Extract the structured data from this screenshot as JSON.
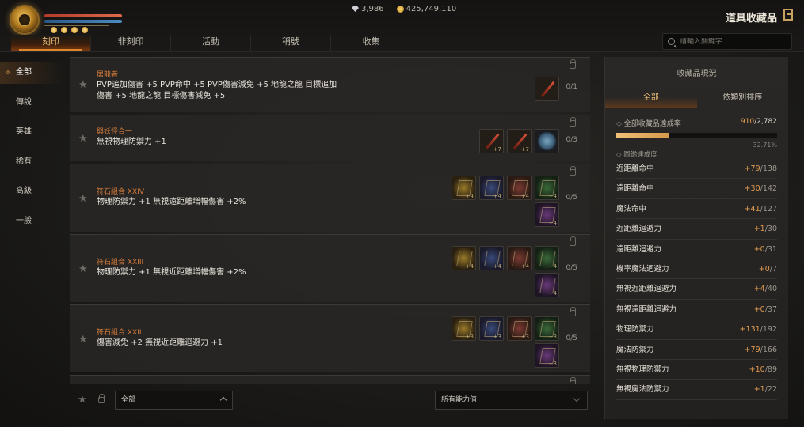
{
  "currency": {
    "gems": "3,986",
    "gold": "425,749,110"
  },
  "header": {
    "title": "道具收藏品"
  },
  "tabs": [
    {
      "label": "刻印",
      "active": true
    },
    {
      "label": "非刻印",
      "active": false
    },
    {
      "label": "活動",
      "active": false
    },
    {
      "label": "稱號",
      "active": false
    },
    {
      "label": "收集",
      "active": false
    }
  ],
  "search": {
    "placeholder": "請輸入關鍵字."
  },
  "sidebar": {
    "items": [
      {
        "label": "全部",
        "active": true
      },
      {
        "label": "傳說",
        "active": false
      },
      {
        "label": "英雄",
        "active": false
      },
      {
        "label": "稀有",
        "active": false
      },
      {
        "label": "高級",
        "active": false
      },
      {
        "label": "一般",
        "active": false
      }
    ]
  },
  "collections": [
    {
      "category": "屠龍者",
      "desc_line1": "PVP追加傷害 +5 PVP命中 +5 PVP傷害減免 +5 地龍之龍 目標追加",
      "desc_line2": "傷害 +5 地龍之龍 目標傷害減免 +5",
      "count": "0/1",
      "slots": [
        {
          "icon": "sword-icon",
          "plus": ""
        }
      ]
    },
    {
      "category": "與妖怪合一",
      "desc_line1": "無視物理防禦力 +1",
      "count": "0/3",
      "slots": [
        {
          "icon": "sword-icon",
          "plus": "+7"
        },
        {
          "icon": "sword-icon",
          "plus": "+7"
        },
        {
          "icon": "orb-icon",
          "plus": ""
        }
      ]
    },
    {
      "category": "符石組合 XXIV",
      "desc_line1": "物理防禦力 +1 無視遠距離增幅傷害 +2%",
      "count": "0/5",
      "slots": [
        {
          "icon": "rune-gold-icon",
          "plus": "+4"
        },
        {
          "icon": "rune-blue-icon",
          "plus": "+4"
        },
        {
          "icon": "rune-red-icon",
          "plus": "+4"
        },
        {
          "icon": "rune-green-icon",
          "plus": "+4"
        },
        {
          "icon": "rune-purple-icon",
          "plus": "+4"
        }
      ]
    },
    {
      "category": "符石組合 XXIII",
      "desc_line1": "物理防禦力 +1 無視近距離增幅傷害 +2%",
      "count": "0/5",
      "slots": [
        {
          "icon": "rune-gold-icon",
          "plus": "+4"
        },
        {
          "icon": "rune-blue-icon",
          "plus": "+4"
        },
        {
          "icon": "rune-red-icon",
          "plus": "+4"
        },
        {
          "icon": "rune-green-icon",
          "plus": "+4"
        },
        {
          "icon": "rune-purple-icon",
          "plus": "+4"
        }
      ]
    },
    {
      "category": "符石組合 XXII",
      "desc_line1": "傷害減免 +2 無視近距離迴避力 +1",
      "count": "0/5",
      "slots": [
        {
          "icon": "rune-gold-icon",
          "plus": "+3"
        },
        {
          "icon": "rune-blue-icon",
          "plus": "+3"
        },
        {
          "icon": "rune-red-icon",
          "plus": "+3"
        },
        {
          "icon": "rune-green-icon",
          "plus": "+3"
        },
        {
          "icon": "rune-purple-icon",
          "plus": "+3"
        }
      ]
    }
  ],
  "filters": {
    "grade": "全部",
    "stat": "所有能力值"
  },
  "panel": {
    "title": "收藏品現況",
    "tabs": [
      {
        "label": "全部",
        "active": true
      },
      {
        "label": "依類別排序",
        "active": false
      }
    ],
    "summary_label": "全部收藏品達成率",
    "summary_current": "910",
    "summary_total": "/2,782",
    "summary_fraction": 0.3271,
    "summary_percent": "32.71%",
    "subtitle": "圖鑑達成度",
    "stats": [
      {
        "name": "近距離命中",
        "inc": "+79",
        "total": "/138"
      },
      {
        "name": "遠距離命中",
        "inc": "+30",
        "total": "/142"
      },
      {
        "name": "魔法命中",
        "inc": "+41",
        "total": "/127"
      },
      {
        "name": "近距離迴避力",
        "inc": "+1",
        "total": "/30"
      },
      {
        "name": "遠距離迴避力",
        "inc": "+0",
        "total": "/31"
      },
      {
        "name": "機率魔法迴避力",
        "inc": "+0",
        "total": "/7"
      },
      {
        "name": "無視近距離迴避力",
        "inc": "+4",
        "total": "/40"
      },
      {
        "name": "無視遠距離迴避力",
        "inc": "+0",
        "total": "/37"
      },
      {
        "name": "物理防禦力",
        "inc": "+131",
        "total": "/192"
      },
      {
        "name": "魔法防禦力",
        "inc": "+79",
        "total": "/166"
      },
      {
        "name": "無視物理防禦力",
        "inc": "+10",
        "total": "/89"
      },
      {
        "name": "無視魔法防禦力",
        "inc": "+1",
        "total": "/22"
      }
    ]
  },
  "colors": {
    "accent": "#e0862e",
    "highlight": "#f0c078",
    "category": "#d47a3a"
  }
}
